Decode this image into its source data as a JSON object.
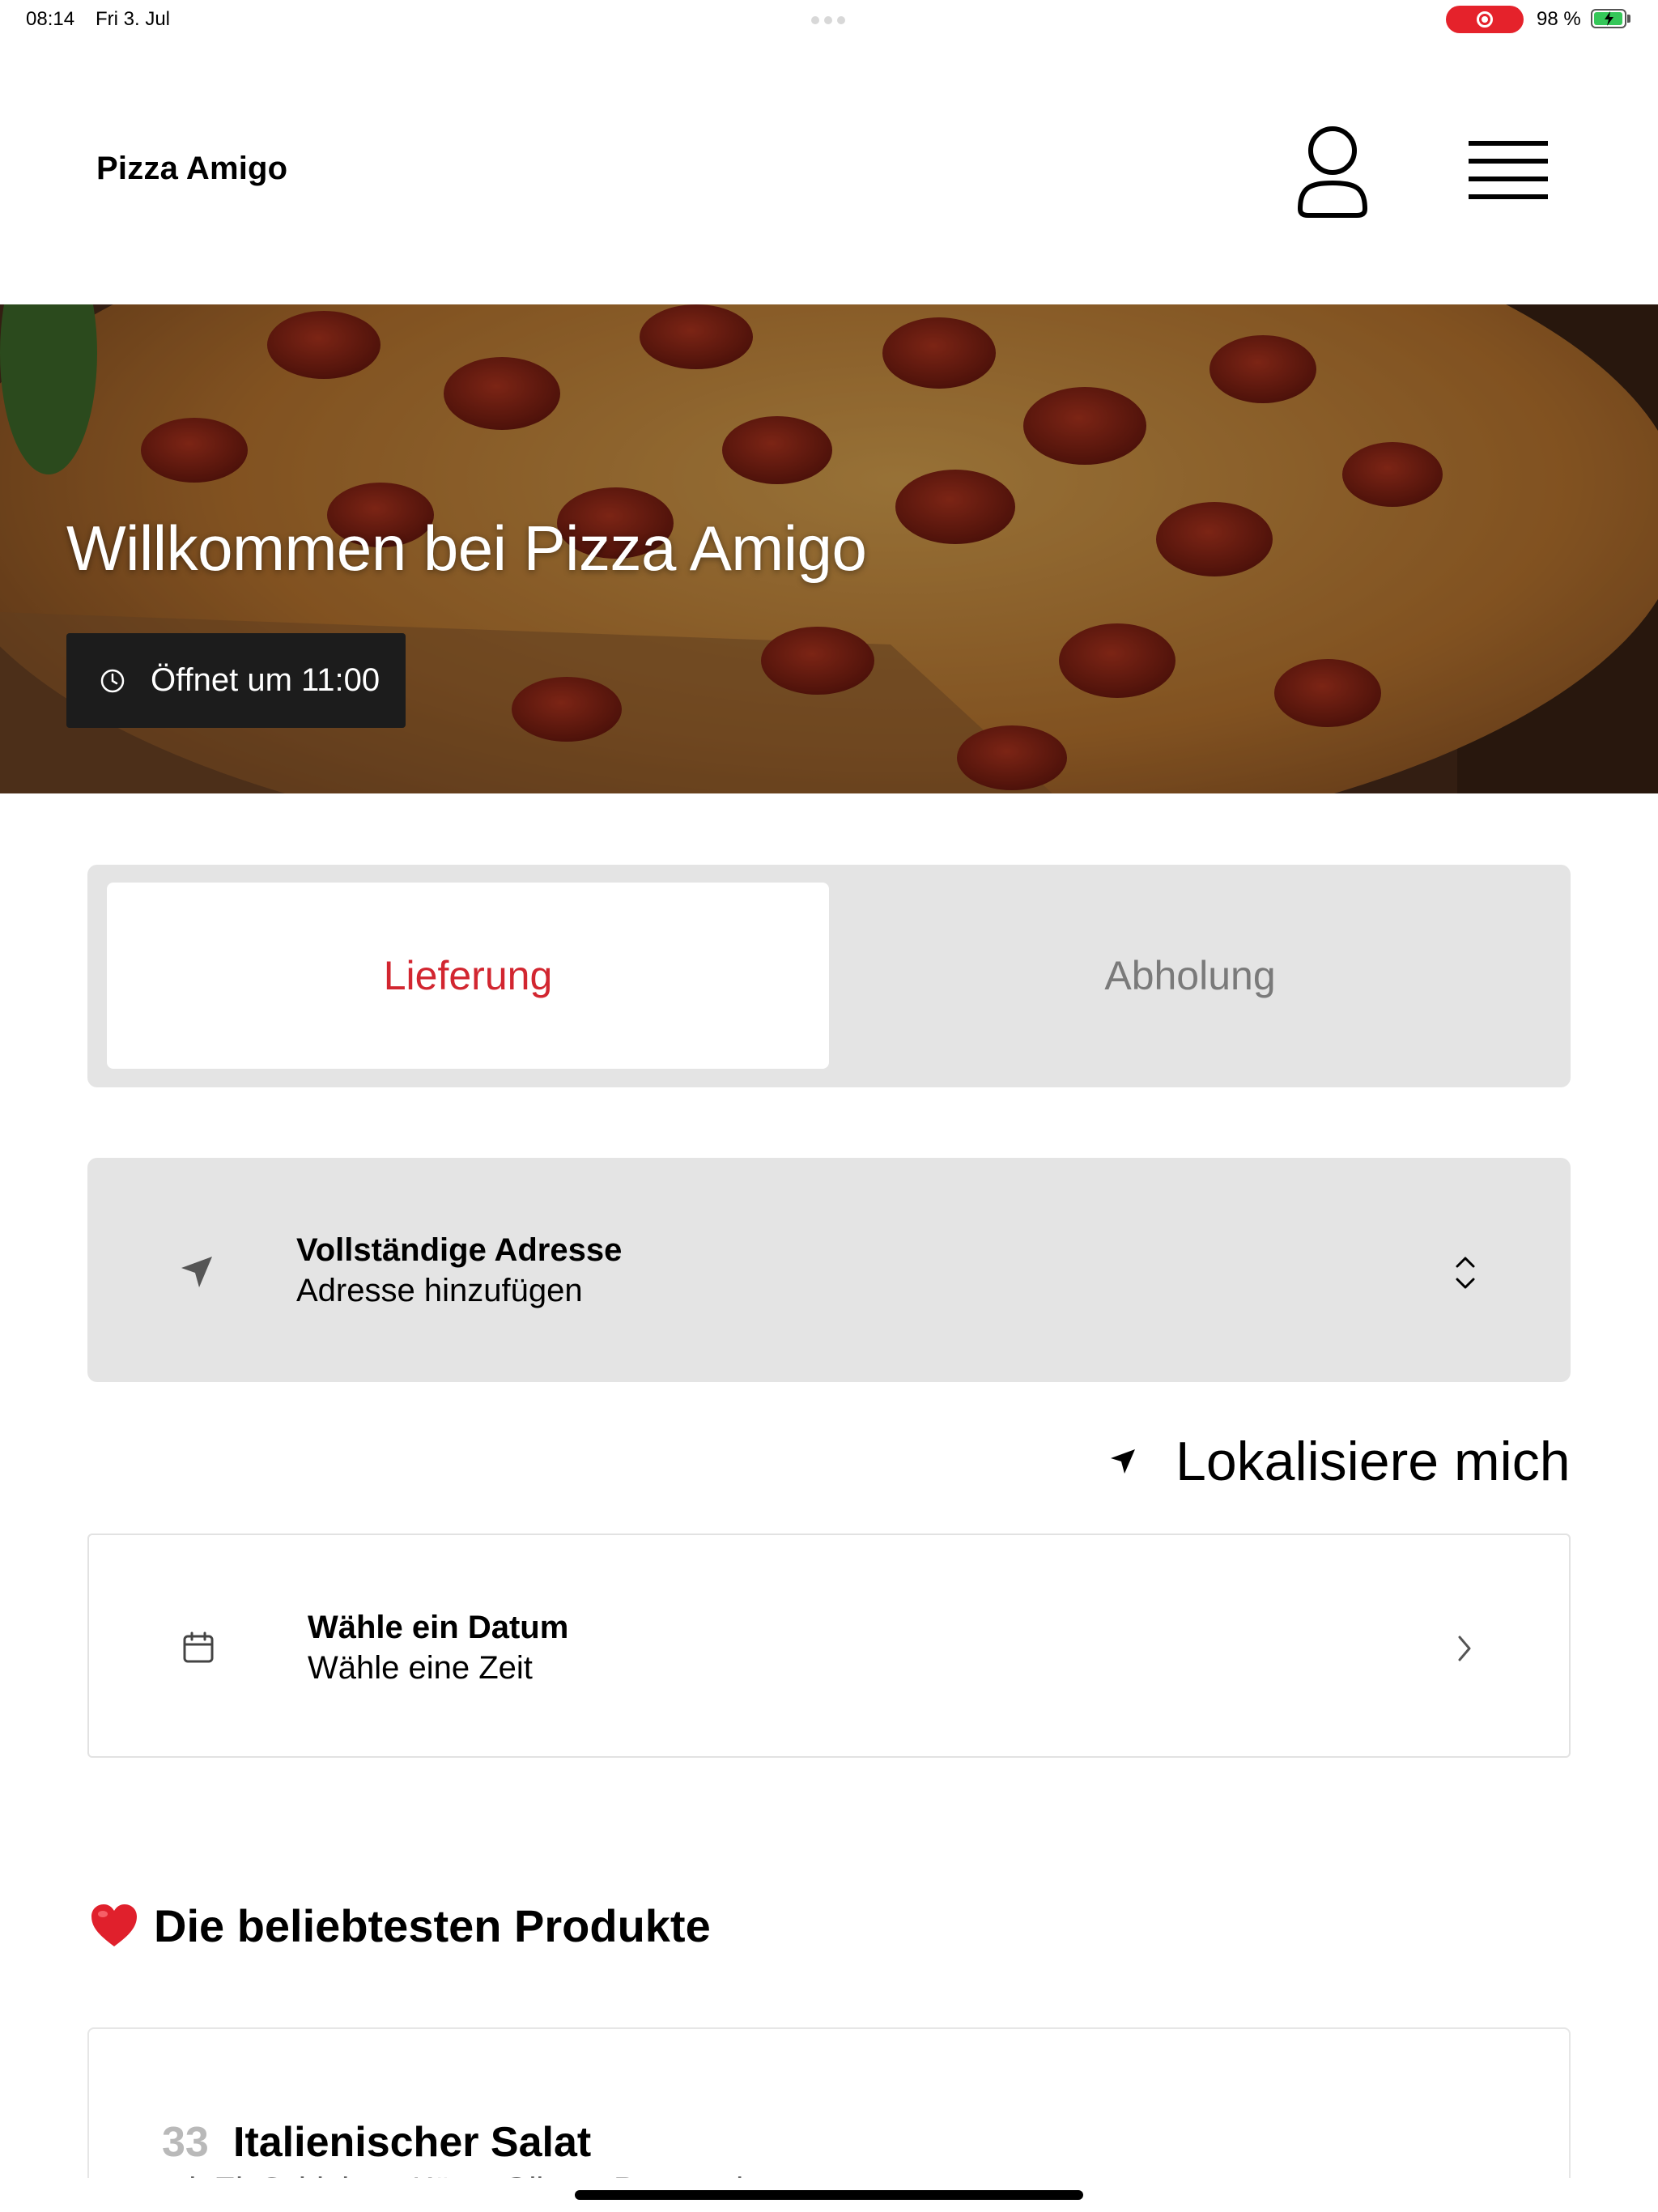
{
  "status_bar": {
    "time": "08:14",
    "date": "Fri 3. Jul",
    "battery_text": "98 %",
    "battery_level": 0.98,
    "recording_color": "#e5222b"
  },
  "header": {
    "brand": "Pizza Amigo",
    "user_icon": "user-icon",
    "menu_icon": "hamburger-menu-icon"
  },
  "hero": {
    "title": "Willkommen bei Pizza Amigo",
    "hours": "Öffnet um 11:00",
    "clock_icon": "clock-icon"
  },
  "order_mode": {
    "delivery_label": "Lieferung",
    "pickup_label": "Abholung",
    "selected": "delivery",
    "accent_color": "#d22630"
  },
  "address": {
    "title": "Vollständige Adresse",
    "subtitle": "Adresse hinzufügen",
    "icon": "location-arrow-icon"
  },
  "locate": {
    "label": "Lokalisiere mich",
    "icon": "location-arrow-icon"
  },
  "schedule": {
    "title": "Wähle ein Datum",
    "subtitle": "Wähle eine Zeit",
    "icon": "calendar-icon"
  },
  "popular": {
    "title": "Die beliebtesten Produkte",
    "icon": "heart-icon",
    "products": [
      {
        "number": "33",
        "name": "Italienischer Salat",
        "description": "mit Ei, Schinken, Käse, Oliven, Peperoni"
      }
    ]
  }
}
